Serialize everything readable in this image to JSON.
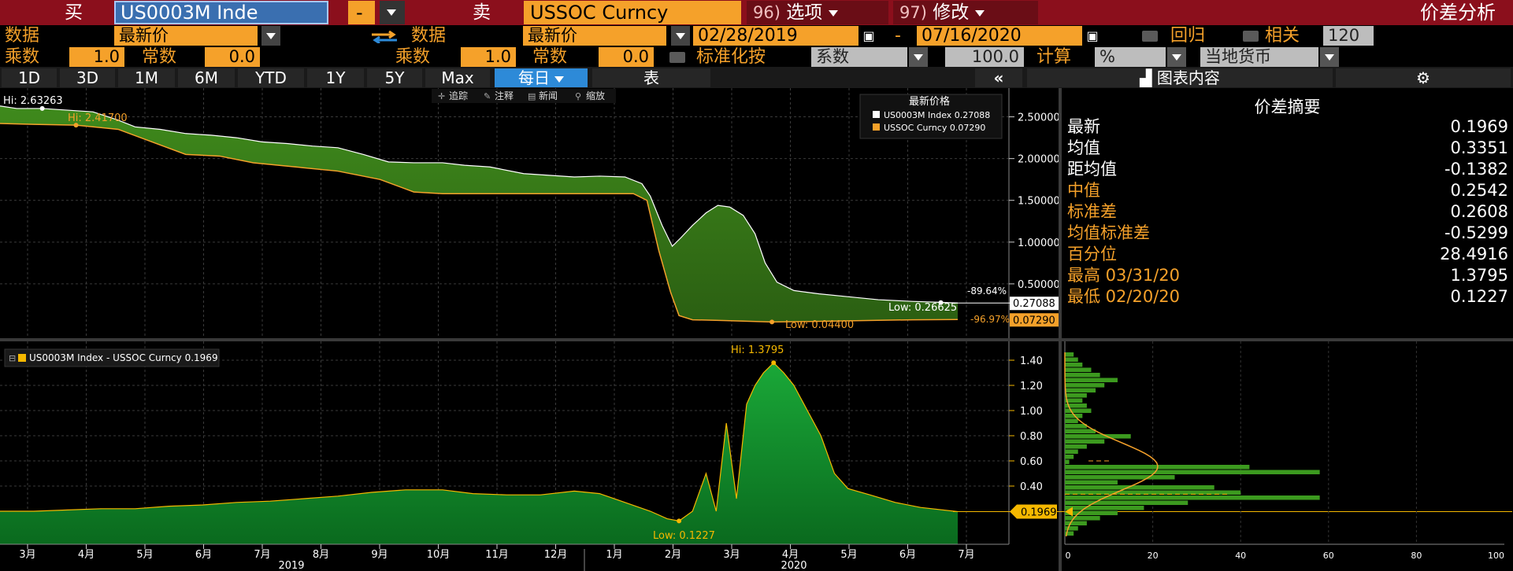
{
  "header": {
    "buy_label": "买",
    "buy_security": "US0003M Inde",
    "buy_dash": "-",
    "sell_label": "卖",
    "sell_security": "USSOC Curncy",
    "options_num": "96)",
    "options_label": "选项",
    "modify_num": "97)",
    "modify_label": "修改",
    "title": "价差分析"
  },
  "row2": {
    "data_label": "数据",
    "data_value": "最新价",
    "data_label2": "数据",
    "data_value2": "最新价",
    "start_date": "02/28/2019",
    "dash": "-",
    "end_date": "07/16/2020",
    "regress_label": "回归",
    "corr_label": "相关",
    "corr_value": "120"
  },
  "row3": {
    "mult_label": "乘数",
    "mult_value": "1.0",
    "const_label": "常数",
    "const_value": "0.0",
    "mult_label2": "乘数",
    "mult_value2": "1.0",
    "const_label2": "常数",
    "const_value2": "0.0",
    "normalize_label": "标准化按",
    "normalize_value": "系数",
    "normalize_num": "100.0",
    "calc_label": "计算",
    "calc_value": "%",
    "currency_value": "当地货币"
  },
  "tabs": {
    "periods": [
      "1D",
      "3D",
      "1M",
      "6M",
      "YTD",
      "1Y",
      "5Y",
      "Max"
    ],
    "freq": "每日",
    "table": "表",
    "collapse": "«",
    "chart_content": "图表内容"
  },
  "toolbar": [
    "追踪",
    "注释",
    "新闻",
    "缩放"
  ],
  "summary": {
    "title": "价差摘要",
    "rows": [
      {
        "k": "最新",
        "v": "0.1969",
        "style": "w"
      },
      {
        "k": "均值",
        "v": "0.3351",
        "style": "w"
      },
      {
        "k": "距均值",
        "v": "-0.1382",
        "style": "w"
      },
      {
        "k": "中值",
        "v": "0.2542",
        "style": "o"
      },
      {
        "k": "标准差",
        "v": "0.2608",
        "style": "o"
      },
      {
        "k": "均值标准差",
        "v": "-0.5299",
        "style": "o"
      },
      {
        "k": "百分位",
        "v": "28.4916",
        "style": "o"
      },
      {
        "k": "最高 03/31/20",
        "v": "1.3795",
        "style": "o"
      },
      {
        "k": "最低 02/20/20",
        "v": "0.1227",
        "style": "o"
      }
    ]
  },
  "colors": {
    "header_red": "#8b0f1c",
    "orange": "#f5a12a",
    "series1": "#ffffff",
    "series2": "#f5a12a",
    "fill_top": "#3a7a17",
    "fill_bottom": "#0f8a2a",
    "spread_line": "#f5b800"
  },
  "chart_data": [
    {
      "type": "line",
      "legend_title": "最新价格",
      "ylim": [
        0,
        2.75
      ],
      "yticks": [
        "2.50000",
        "2.00000",
        "1.50000",
        "1.00000",
        "0.50000"
      ],
      "series": [
        {
          "name": "US0003M Index",
          "last_label": "0.27088",
          "hi_label": "Hi: 2.63263",
          "low_label": "Low: 0.26625",
          "change_label": "-89.64%",
          "points": [
            [
              0,
              2.63
            ],
            [
              10,
              2.6
            ],
            [
              25,
              2.6
            ],
            [
              40,
              2.58
            ],
            [
              55,
              2.56
            ],
            [
              70,
              2.46
            ],
            [
              80,
              2.38
            ],
            [
              95,
              2.35
            ],
            [
              110,
              2.3
            ],
            [
              125,
              2.28
            ],
            [
              140,
              2.25
            ],
            [
              155,
              2.2
            ],
            [
              170,
              2.18
            ],
            [
              185,
              2.15
            ],
            [
              200,
              2.13
            ],
            [
              215,
              2.05
            ],
            [
              230,
              1.96
            ],
            [
              245,
              1.95
            ],
            [
              262,
              1.95
            ],
            [
              275,
              1.92
            ],
            [
              290,
              1.9
            ],
            [
              310,
              1.82
            ],
            [
              325,
              1.8
            ],
            [
              340,
              1.78
            ],
            [
              355,
              1.79
            ],
            [
              370,
              1.78
            ],
            [
              380,
              1.7
            ],
            [
              385,
              1.55
            ],
            [
              392,
              1.2
            ],
            [
              398,
              0.95
            ],
            [
              403,
              1.05
            ],
            [
              410,
              1.2
            ],
            [
              418,
              1.35
            ],
            [
              425,
              1.44
            ],
            [
              432,
              1.42
            ],
            [
              440,
              1.32
            ],
            [
              447,
              1.1
            ],
            [
              453,
              0.75
            ],
            [
              460,
              0.52
            ],
            [
              470,
              0.42
            ],
            [
              485,
              0.38
            ],
            [
              500,
              0.35
            ],
            [
              520,
              0.31
            ],
            [
              540,
              0.29
            ],
            [
              555,
              0.28
            ],
            [
              567,
              0.271
            ]
          ]
        },
        {
          "name": "USSOC Curncy",
          "last_label": "0.07290",
          "hi_label": "Hi: 2.41700",
          "low_label": "Low: 0.04400",
          "change_label": "-96.97%",
          "points": [
            [
              0,
              2.42
            ],
            [
              20,
              2.41
            ],
            [
              45,
              2.4
            ],
            [
              70,
              2.35
            ],
            [
              90,
              2.2
            ],
            [
              110,
              2.05
            ],
            [
              130,
              2.03
            ],
            [
              150,
              1.95
            ],
            [
              175,
              1.9
            ],
            [
              200,
              1.85
            ],
            [
              225,
              1.75
            ],
            [
              245,
              1.6
            ],
            [
              262,
              1.58
            ],
            [
              280,
              1.58
            ],
            [
              300,
              1.58
            ],
            [
              320,
              1.58
            ],
            [
              340,
              1.58
            ],
            [
              360,
              1.58
            ],
            [
              375,
              1.58
            ],
            [
              383,
              1.5
            ],
            [
              390,
              0.9
            ],
            [
              397,
              0.4
            ],
            [
              402,
              0.12
            ],
            [
              410,
              0.07
            ],
            [
              430,
              0.06
            ],
            [
              457,
              0.044
            ],
            [
              480,
              0.05
            ],
            [
              510,
              0.06
            ],
            [
              540,
              0.07
            ],
            [
              567,
              0.0729
            ]
          ]
        }
      ]
    },
    {
      "type": "area",
      "legend": "US0003M Index - USSOC Curncy 0.1969",
      "ylim": [
        0,
        1.5
      ],
      "yticks": [
        "1.40",
        "1.20",
        "1.00",
        "0.80",
        "0.60",
        "0.40"
      ],
      "last_label": "0.1969",
      "hi_label": "Hi: 1.3795",
      "low_label": "Low: 0.1227",
      "x_months": [
        "3月",
        "4月",
        "5月",
        "6月",
        "7月",
        "8月",
        "9月",
        "10月",
        "11月",
        "12月",
        "1月",
        "2月",
        "3月",
        "4月",
        "5月",
        "6月",
        "7月"
      ],
      "x_years": [
        "2019",
        "2020"
      ],
      "values": [
        [
          0,
          0.2
        ],
        [
          20,
          0.2
        ],
        [
          40,
          0.21
        ],
        [
          60,
          0.22
        ],
        [
          80,
          0.22
        ],
        [
          100,
          0.24
        ],
        [
          120,
          0.25
        ],
        [
          140,
          0.27
        ],
        [
          160,
          0.28
        ],
        [
          180,
          0.3
        ],
        [
          200,
          0.32
        ],
        [
          220,
          0.35
        ],
        [
          240,
          0.37
        ],
        [
          262,
          0.37
        ],
        [
          280,
          0.34
        ],
        [
          300,
          0.33
        ],
        [
          320,
          0.33
        ],
        [
          340,
          0.36
        ],
        [
          355,
          0.34
        ],
        [
          370,
          0.27
        ],
        [
          385,
          0.2
        ],
        [
          395,
          0.14
        ],
        [
          402,
          0.1227
        ],
        [
          410,
          0.2
        ],
        [
          418,
          0.5
        ],
        [
          424,
          0.2
        ],
        [
          430,
          0.9
        ],
        [
          436,
          0.3
        ],
        [
          442,
          1.05
        ],
        [
          447,
          1.2
        ],
        [
          452,
          1.3
        ],
        [
          458,
          1.3795
        ],
        [
          464,
          1.3
        ],
        [
          470,
          1.2
        ],
        [
          478,
          1.0
        ],
        [
          486,
          0.8
        ],
        [
          494,
          0.5
        ],
        [
          502,
          0.38
        ],
        [
          515,
          0.33
        ],
        [
          530,
          0.27
        ],
        [
          545,
          0.23
        ],
        [
          567,
          0.1969
        ]
      ]
    },
    {
      "type": "bar",
      "orientation": "horizontal",
      "xticks": [
        "0",
        "20",
        "40",
        "60",
        "80",
        "100"
      ],
      "values": [
        2,
        3,
        4,
        6,
        8,
        12,
        9,
        7,
        5,
        4,
        5,
        6,
        4,
        3,
        5,
        7,
        15,
        9,
        5,
        3,
        2,
        1,
        42,
        58,
        25,
        12,
        34,
        40,
        58,
        28,
        18,
        12,
        8,
        5,
        3,
        2
      ]
    }
  ]
}
